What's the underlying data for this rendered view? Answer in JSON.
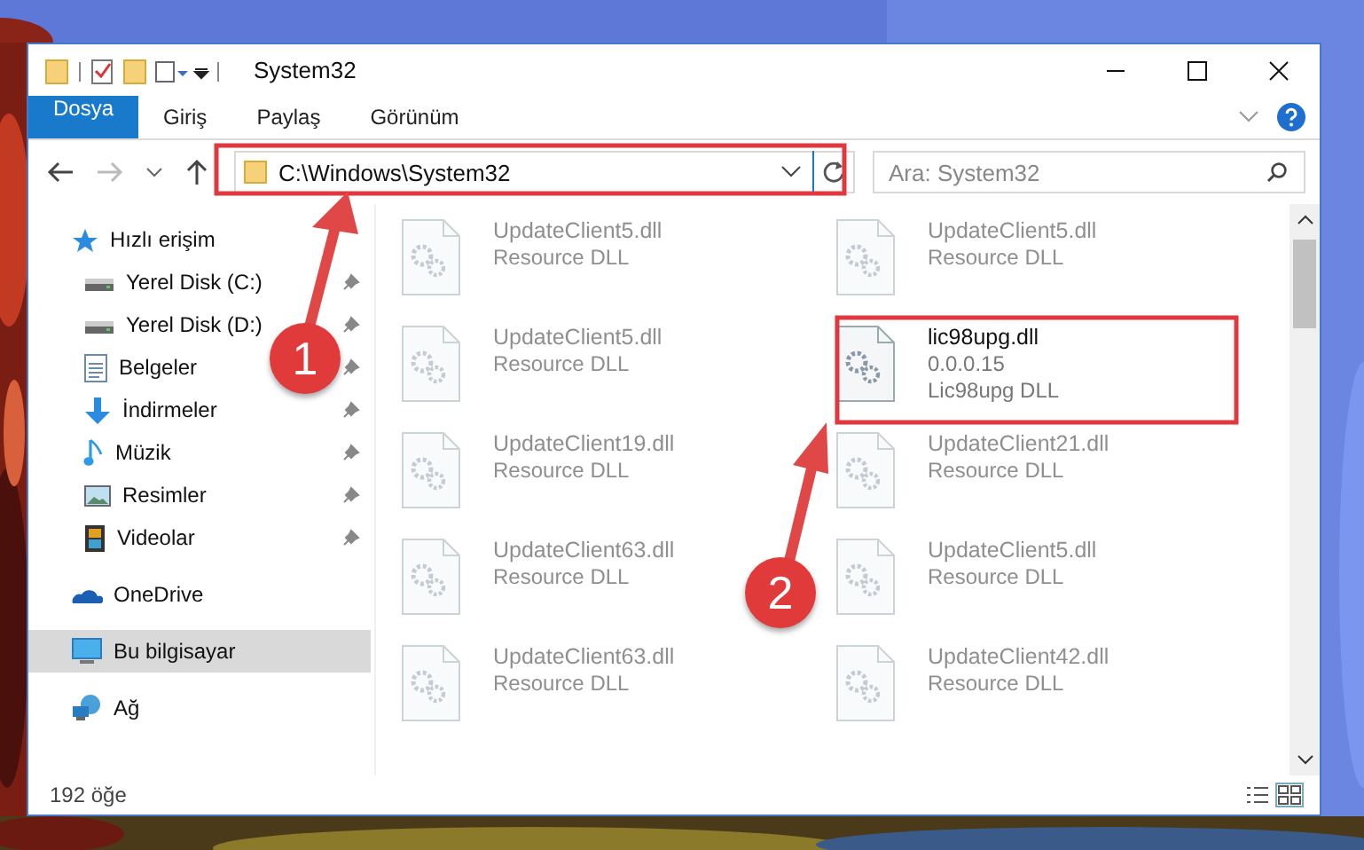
{
  "window": {
    "title": "System32"
  },
  "ribbon": {
    "tabs": [
      {
        "label": "Dosya",
        "kind": "file-menu"
      },
      {
        "label": "Giriş",
        "kind": "tab"
      },
      {
        "label": "Paylaş",
        "kind": "tab"
      },
      {
        "label": "Görünüm",
        "kind": "tab"
      }
    ]
  },
  "address_bar": {
    "path": "C:\\Windows\\System32"
  },
  "search": {
    "placeholder": "Ara: System32"
  },
  "sidebar": {
    "items": [
      {
        "label": "Hızlı erişim",
        "selected": false,
        "children": [
          {
            "label": "Yerel Disk (C:)",
            "pinned": true,
            "selected": false
          },
          {
            "label": "Yerel Disk (D:)",
            "pinned": true,
            "selected": false
          },
          {
            "label": "Belgeler",
            "pinned": true,
            "selected": false
          },
          {
            "label": "İndirmeler",
            "pinned": true,
            "selected": false
          },
          {
            "label": "Müzik",
            "pinned": true,
            "selected": false
          },
          {
            "label": "Resimler",
            "pinned": true,
            "selected": false
          },
          {
            "label": "Videolar",
            "pinned": true,
            "selected": false
          }
        ]
      },
      {
        "label": "OneDrive",
        "selected": false
      },
      {
        "label": "Bu bilgisayar",
        "selected": true
      },
      {
        "label": "Ağ",
        "selected": false
      }
    ]
  },
  "files": [
    {
      "name": "UpdateClient5.dll",
      "details": [
        "Resource DLL"
      ],
      "blurred": true
    },
    {
      "name": "UpdateClient5.dll",
      "details": [
        "Resource DLL"
      ],
      "blurred": true
    },
    {
      "name": "UpdateClient5.dll",
      "details": [
        "Resource DLL"
      ],
      "blurred": true
    },
    {
      "name": "lic98upg.dll",
      "details": [
        "0.0.0.15",
        "Lic98upg DLL"
      ],
      "blurred": false
    },
    {
      "name": "UpdateClient19.dll",
      "details": [
        "Resource DLL"
      ],
      "blurred": true
    },
    {
      "name": "UpdateClient21.dll",
      "details": [
        "Resource DLL"
      ],
      "blurred": true
    },
    {
      "name": "UpdateClient63.dll",
      "details": [
        "Resource DLL"
      ],
      "blurred": true
    },
    {
      "name": "UpdateClient5.dll",
      "details": [
        "Resource DLL"
      ],
      "blurred": true
    },
    {
      "name": "UpdateClient63.dll",
      "details": [
        "Resource DLL"
      ],
      "blurred": true
    },
    {
      "name": "UpdateClient42.dll",
      "details": [
        "Resource DLL"
      ],
      "blurred": true
    }
  ],
  "status_bar": {
    "count": "192 öğe"
  },
  "annotations": {
    "steps": [
      {
        "number": "1"
      },
      {
        "number": "2"
      }
    ]
  }
}
